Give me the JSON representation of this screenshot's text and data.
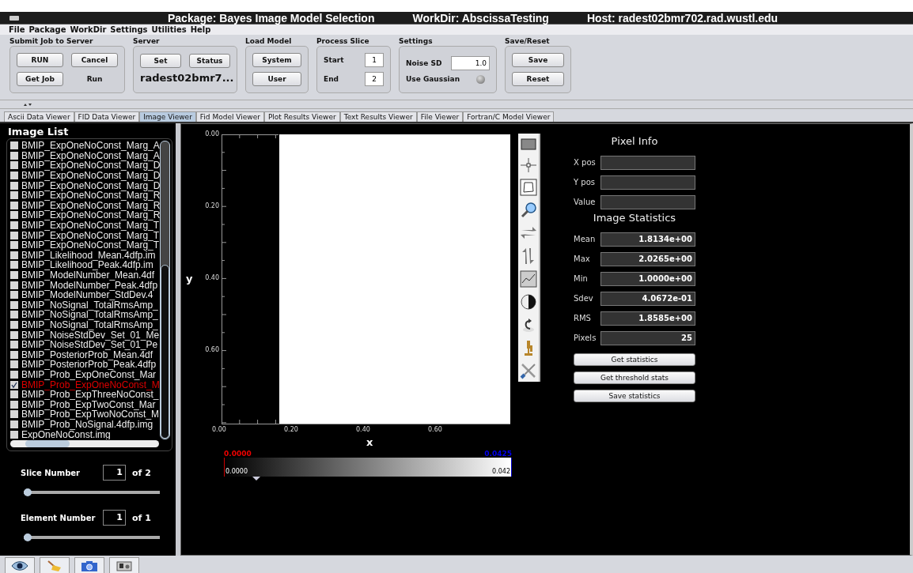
{
  "window": {
    "title": "Package: Bayes Image Model Selection",
    "workdir": "WorkDir: AbscissaTesting",
    "host": "Host: radest02bmr702.rad.wustl.edu"
  },
  "menu": [
    "File",
    "Package",
    "WorkDir",
    "Settings",
    "Utilities",
    "Help"
  ],
  "toolbar": {
    "submit": {
      "title": "Submit Job to Server",
      "buttons": [
        "RUN",
        "Cancel",
        "Get Job"
      ],
      "status": "Run"
    },
    "server": {
      "title": "Server",
      "buttons": [
        "Set",
        "Status"
      ],
      "host": "radest02bmr7..."
    },
    "load_model": {
      "title": "Load Model",
      "buttons": [
        "System",
        "User"
      ]
    },
    "process_slice": {
      "title": "Process Slice",
      "fields": [
        {
          "label": "Start",
          "value": "1"
        },
        {
          "label": "End",
          "value": "2"
        }
      ]
    },
    "settings": {
      "title": "Settings",
      "noise_label": "Noise SD",
      "noise_value": "1.0",
      "gaussian_label": "Use Gaussian",
      "gaussian_on": false
    },
    "save_reset": {
      "title": "Save/Reset",
      "buttons": [
        "Save",
        "Reset"
      ]
    }
  },
  "tabs": [
    {
      "label": "Ascii Data Viewer",
      "selected": false
    },
    {
      "label": "FID Data Viewer",
      "selected": false
    },
    {
      "label": "Image Viewer",
      "selected": true
    },
    {
      "label": "Fid Model Viewer",
      "selected": false
    },
    {
      "label": "Plot Results Viewer",
      "selected": false
    },
    {
      "label": "Text Results Viewer",
      "selected": false
    },
    {
      "label": "File Viewer",
      "selected": false
    },
    {
      "label": "Fortran/C Model Viewer",
      "selected": false
    }
  ],
  "image_list": {
    "title": "Image List",
    "items": [
      {
        "label": "BMIP_ExpOneNoConst_Marg_A",
        "checked": false
      },
      {
        "label": "BMIP_ExpOneNoConst_Marg_A",
        "checked": false
      },
      {
        "label": "BMIP_ExpOneNoConst_Marg_D",
        "checked": false
      },
      {
        "label": "BMIP_ExpOneNoConst_Marg_D",
        "checked": false
      },
      {
        "label": "BMIP_ExpOneNoConst_Marg_D",
        "checked": false
      },
      {
        "label": "BMIP_ExpOneNoConst_Marg_R",
        "checked": false
      },
      {
        "label": "BMIP_ExpOneNoConst_Marg_R",
        "checked": false
      },
      {
        "label": "BMIP_ExpOneNoConst_Marg_R",
        "checked": false
      },
      {
        "label": "BMIP_ExpOneNoConst_Marg_T",
        "checked": false
      },
      {
        "label": "BMIP_ExpOneNoConst_Marg_T",
        "checked": false
      },
      {
        "label": "BMIP_ExpOneNoConst_Marg_T",
        "checked": false
      },
      {
        "label": "BMIP_Likelihood_Mean.4dfp.im",
        "checked": false
      },
      {
        "label": "BMIP_Likelihood_Peak.4dfp.im",
        "checked": false
      },
      {
        "label": "BMIP_ModelNumber_Mean.4df",
        "checked": false
      },
      {
        "label": "BMIP_ModelNumber_Peak.4dfp",
        "checked": false
      },
      {
        "label": "BMIP_ModelNumber_StdDev.4",
        "checked": false
      },
      {
        "label": "BMIP_NoSignal_TotalRmsAmp_",
        "checked": false
      },
      {
        "label": "BMIP_NoSignal_TotalRmsAmp_",
        "checked": false
      },
      {
        "label": "BMIP_NoSignal_TotalRmsAmp_",
        "checked": false
      },
      {
        "label": "BMIP_NoiseStdDev_Set_01_Me",
        "checked": false
      },
      {
        "label": "BMIP_NoiseStdDev_Set_01_Pe",
        "checked": false
      },
      {
        "label": "BMIP_PosteriorProb_Mean.4df",
        "checked": false
      },
      {
        "label": "BMIP_PosteriorProb_Peak.4dfp",
        "checked": false
      },
      {
        "label": "BMIP_Prob_ExpOneConst_Mar",
        "checked": false
      },
      {
        "label": "BMIP_Prob_ExpOneNoConst_M",
        "checked": true
      },
      {
        "label": "BMIP_Prob_ExpThreeNoConst_",
        "checked": false
      },
      {
        "label": "BMIP_Prob_ExpTwoConst_Mar",
        "checked": false
      },
      {
        "label": "BMIP_Prob_ExpTwoNoConst_M",
        "checked": false
      },
      {
        "label": "BMIP_Prob_NoSignal.4dfp.img",
        "checked": false
      },
      {
        "label": "ExpOneNoConst.img",
        "checked": false
      }
    ]
  },
  "slice": {
    "label": "Slice Number",
    "value": "1",
    "of": "of 2",
    "level": 0
  },
  "element": {
    "label": "Element Number",
    "value": "1",
    "of": "of 1",
    "level": 0
  },
  "viewer": {
    "y_label": "y",
    "x_label": "x",
    "y_ticks": [
      "0.00",
      "0.20",
      "0.40",
      "0.60"
    ],
    "x_ticks": [
      "0.00",
      "0.20",
      "0.40",
      "0.60"
    ],
    "colorbar": {
      "min": "0.0000",
      "max": "0.0425",
      "inner_min": "0.0000",
      "inner_max": "0.042"
    }
  },
  "pixel_info": {
    "title": "Pixel Info",
    "fields": [
      "X pos",
      "Y pos",
      "Value"
    ]
  },
  "statistics": {
    "title": "Image Statistics",
    "rows": [
      {
        "label": "Mean",
        "value": "1.8134e+00"
      },
      {
        "label": "Max",
        "value": "2.0265e+00"
      },
      {
        "label": "Min",
        "value": "1.0000e+00"
      },
      {
        "label": "Sdev",
        "value": "4.0672e-01"
      },
      {
        "label": "RMS",
        "value": "1.8585e+00"
      },
      {
        "label": "Pixels",
        "value": "25"
      }
    ]
  },
  "stat_buttons": [
    "Get statistics",
    "Get threshold stats",
    "Save statistics"
  ]
}
